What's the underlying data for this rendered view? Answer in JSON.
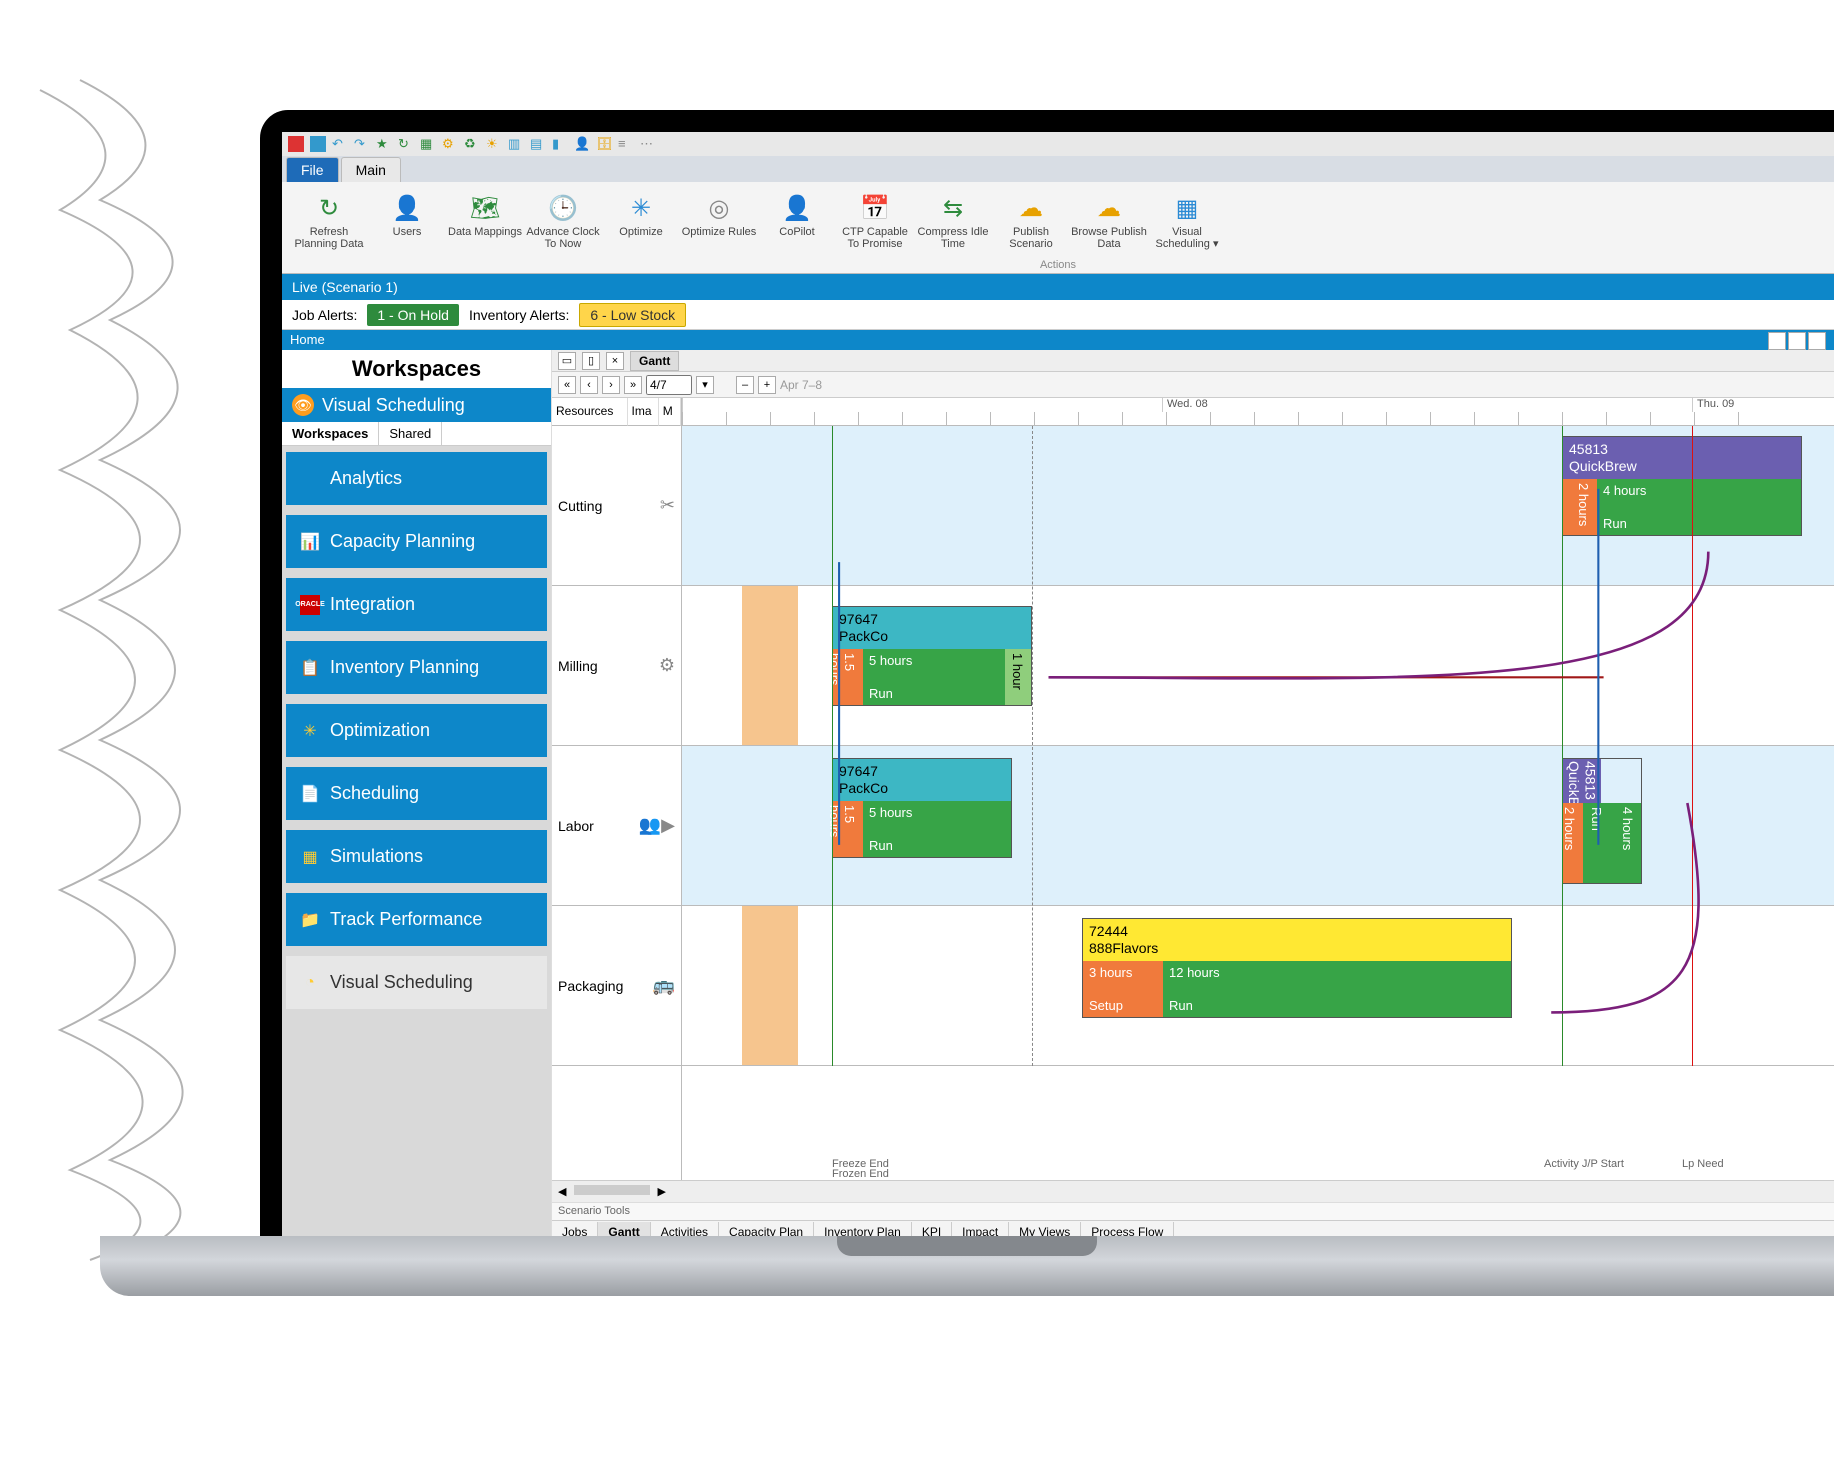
{
  "qat_icons": [
    "doc-icon",
    "save-icon",
    "undo-icon",
    "redo-icon",
    "star-icon",
    "refresh-icon",
    "calendar-icon",
    "gear-icon",
    "recycle-icon",
    "sun-icon",
    "grid1-icon",
    "grid2-icon",
    "chart-icon",
    "user-icon",
    "db-icon",
    "bars-icon",
    "dots-icon"
  ],
  "ribbon": {
    "tabs": {
      "file": "File",
      "main": "Main"
    },
    "group_label": "Actions",
    "buttons": [
      {
        "name": "refresh-planning-data",
        "label": "Refresh Planning Data",
        "icon": "↻",
        "color": "#2e8b3d"
      },
      {
        "name": "users",
        "label": "Users",
        "icon": "👤",
        "color": "#2e8b3d"
      },
      {
        "name": "data-mappings",
        "label": "Data Mappings",
        "icon": "🗺",
        "color": "#2e8b3d"
      },
      {
        "name": "advance-clock",
        "label": "Advance Clock To Now",
        "icon": "🕒",
        "color": "#e7a100"
      },
      {
        "name": "optimize",
        "label": "Optimize",
        "icon": "✳",
        "color": "#2a8ad4"
      },
      {
        "name": "optimize-rules",
        "label": "Optimize Rules",
        "icon": "◎",
        "color": "#888"
      },
      {
        "name": "copilot",
        "label": "CoPilot",
        "icon": "👤",
        "color": "#2a8ad4"
      },
      {
        "name": "ctp",
        "label": "CTP Capable To Promise",
        "icon": "📅",
        "color": "#2a8ad4"
      },
      {
        "name": "compress-idle",
        "label": "Compress Idle Time",
        "icon": "⇆",
        "color": "#2e8b3d"
      },
      {
        "name": "publish-scenario",
        "label": "Publish Scenario",
        "icon": "☁",
        "color": "#e7a100"
      },
      {
        "name": "browse-publish-data",
        "label": "Browse Publish Data",
        "icon": "☁",
        "color": "#e7a100"
      },
      {
        "name": "visual-scheduling-dd",
        "label": "Visual Scheduling ▾",
        "icon": "▦",
        "color": "#2a8ad4"
      }
    ]
  },
  "scenario_bar": "Live (Scenario 1)",
  "alerts": {
    "job_label": "Job Alerts:",
    "job_chip": "1 - On Hold",
    "inv_label": "Inventory Alerts:",
    "inv_chip": "6 - Low Stock"
  },
  "home_label": "Home",
  "sidebar": {
    "title": "Workspaces",
    "current": "Visual Scheduling",
    "tabs": {
      "workspaces": "Workspaces",
      "shared": "Shared"
    },
    "items": [
      {
        "label": "Analytics",
        "icon": ""
      },
      {
        "label": "Capacity Planning",
        "icon": "📊"
      },
      {
        "label": "Integration",
        "icon": "ORACLE",
        "oracle": true
      },
      {
        "label": "Inventory Planning",
        "icon": "📋"
      },
      {
        "label": "Optimization",
        "icon": "✳"
      },
      {
        "label": "Scheduling",
        "icon": "📄"
      },
      {
        "label": "Simulations",
        "icon": "▦"
      },
      {
        "label": "Track Performance",
        "icon": "📁"
      },
      {
        "label": "Visual Scheduling",
        "icon": "◔",
        "active": true
      }
    ]
  },
  "gantt": {
    "tab_label": "Gantt",
    "toolbar": {
      "date": "4/7",
      "calendar_hint": "Apr 7–8"
    },
    "left_headers": {
      "resources": "Resources",
      "ima": "Ima",
      "m": "M"
    },
    "rows": [
      {
        "label": "Cutting",
        "icon": "✂"
      },
      {
        "label": "Milling",
        "icon": "⚙"
      },
      {
        "label": "Labor",
        "icon": "👥▶"
      },
      {
        "label": "Packaging",
        "icon": "🚌"
      }
    ],
    "timeline": {
      "day1": "Wed. 08",
      "day2": "Thu. 09"
    },
    "tasks": {
      "cutting_qb": {
        "id": "45813",
        "name": "QuickBrew",
        "setup": "2 hours",
        "run_dur": "4 hours",
        "run_label": "Run"
      },
      "milling_packco": {
        "id": "97647",
        "name": "PackCo",
        "setup": "1.5 hours",
        "run_dur": "5 hours",
        "run_label": "Run",
        "end": "1 hour"
      },
      "labor_packco": {
        "id": "97647",
        "name": "PackCo",
        "setup": "1.5 hours",
        "run_dur": "5 hours",
        "run_label": "Run"
      },
      "labor_qb": {
        "id": "45813",
        "name": "QuickBre",
        "setup": "2 hours",
        "run_dur": "4 hours",
        "run_label": "Run"
      },
      "packaging_888": {
        "id": "72444",
        "name": "888Flavors",
        "setup": "3 hours",
        "setup_label": "Setup",
        "run_dur": "12 hours",
        "run_label": "Run"
      }
    },
    "footer": {
      "freeze_end": "Freeze End",
      "frozen_end": "Frozen End",
      "activity_jp": "Activity J/P Start",
      "lp_need": "Lp Need"
    }
  },
  "bottom_tabs": [
    "Jobs",
    "Gantt",
    "Activities",
    "Capacity Plan",
    "Inventory Plan",
    "KPI",
    "Impact",
    "My Views",
    "Process Flow"
  ],
  "footer_caption": "Scenario Tools"
}
